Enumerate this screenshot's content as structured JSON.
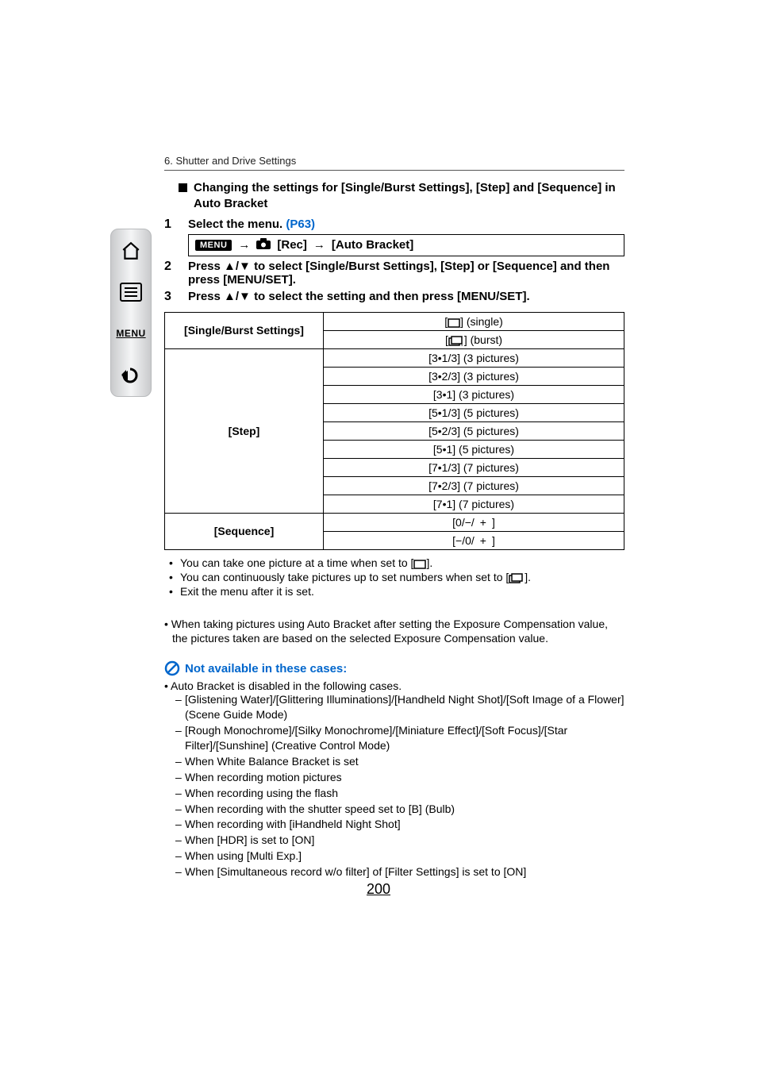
{
  "breadcrumb": "6. Shutter and Drive Settings",
  "section_heading": "Changing the settings for [Single/Burst Settings], [Step] and [Sequence] in Auto Bracket",
  "steps": {
    "s1": {
      "num": "1",
      "text_a": "Select the menu. ",
      "link": "(P63)"
    },
    "s2": {
      "num": "2",
      "text": "Press ▲/▼ to select [Single/Burst Settings], [Step] or [Sequence] and then press [MENU/SET]."
    },
    "s3": {
      "num": "3",
      "text": "Press ▲/▼ to select the setting and then press [MENU/SET]."
    }
  },
  "menu_path": {
    "badge": "MENU",
    "arrow": "→",
    "rec": "[Rec]",
    "target": "[Auto Bracket]"
  },
  "table": {
    "row1_label": "[Single/Burst Settings]",
    "row1_a_suffix": "] (single)",
    "row1_b_suffix": "] (burst)",
    "row2_label": "[Step]",
    "steps": [
      "[3•1/3] (3 pictures)",
      "[3•2/3] (3 pictures)",
      "[3•1] (3 pictures)",
      "[5•1/3] (5 pictures)",
      "[5•2/3] (5 pictures)",
      "[5•1] (5 pictures)",
      "[7•1/3] (7 pictures)",
      "[7•2/3] (7 pictures)",
      "[7•1] (7 pictures)"
    ],
    "row3_label": "[Sequence]",
    "seq": [
      "[0/−/ + ]",
      "[−/0/ + ]"
    ]
  },
  "bullets": {
    "b1_a": "You can take one picture at a time when set to [",
    "b1_b": "].",
    "b2_a": "You can continuously take pictures up to set numbers when set to [",
    "b2_b": "].",
    "b3": "Exit the menu after it is set."
  },
  "note": "When taking pictures using Auto Bracket after setting the Exposure Compensation value, the pictures taken are based on the selected Exposure Compensation value.",
  "unavailable": {
    "heading": "Not available in these cases:",
    "intro": "Auto Bracket is disabled in the following cases.",
    "items": [
      "[Glistening Water]/[Glittering Illuminations]/[Handheld Night Shot]/[Soft Image of a Flower] (Scene Guide Mode)",
      "[Rough Monochrome]/[Silky Monochrome]/[Miniature Effect]/[Soft Focus]/[Star Filter]/[Sunshine] (Creative Control Mode)",
      "When White Balance Bracket is set",
      "When recording motion pictures",
      "When recording using the flash",
      "When recording with the shutter speed set to [B] (Bulb)",
      "When recording with [iHandheld Night Shot]",
      "When [HDR] is set to [ON]",
      "When using [Multi Exp.]",
      "When [Simultaneous record w/o filter] of [Filter Settings] is set to [ON]"
    ]
  },
  "page_number": "200",
  "sidebar": {
    "home": "home-icon",
    "toc": "toc-icon",
    "menu_label": "MENU",
    "back": "back-icon"
  }
}
